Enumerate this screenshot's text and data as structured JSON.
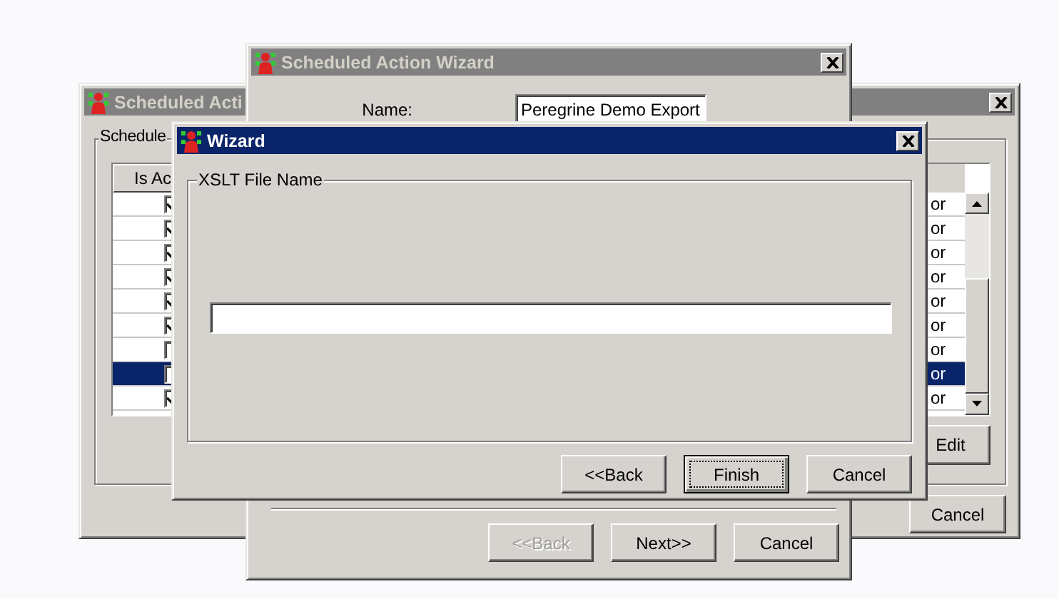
{
  "schedule_window": {
    "title": "Scheduled Acti",
    "active": false,
    "group_label": "Schedule",
    "table": {
      "columns": [
        "Is Ac"
      ],
      "rows": [
        {
          "is_active": true,
          "column_2": "or",
          "selected": false
        },
        {
          "is_active": true,
          "column_2": "or",
          "selected": false
        },
        {
          "is_active": true,
          "column_2": "or",
          "selected": false
        },
        {
          "is_active": true,
          "column_2": "or",
          "selected": false
        },
        {
          "is_active": true,
          "column_2": "or",
          "selected": false
        },
        {
          "is_active": true,
          "column_2": "or",
          "selected": false
        },
        {
          "is_active": false,
          "column_2": "or",
          "selected": false
        },
        {
          "is_active": false,
          "column_2": "or",
          "selected": true
        },
        {
          "is_active": true,
          "column_2": "or",
          "selected": false
        }
      ]
    },
    "buttons": [
      {
        "label": "Edit",
        "disabled": false
      },
      {
        "label": "Cancel",
        "disabled": false
      }
    ]
  },
  "action_wizard": {
    "title": "Scheduled Action Wizard",
    "active": false,
    "name_label": "Name:",
    "name_value": "Peregrine Demo Export",
    "buttons": [
      {
        "label": "<<Back",
        "disabled": true
      },
      {
        "label": "Next>>",
        "disabled": false
      },
      {
        "label": "Cancel",
        "disabled": false
      }
    ]
  },
  "wizard": {
    "title": "Wizard",
    "active": true,
    "group_label": "XSLT File Name",
    "buttons": [
      {
        "label": "<<Back",
        "focused": false
      },
      {
        "label": "Finish",
        "focused": true
      },
      {
        "label": "Cancel",
        "focused": false
      }
    ]
  }
}
